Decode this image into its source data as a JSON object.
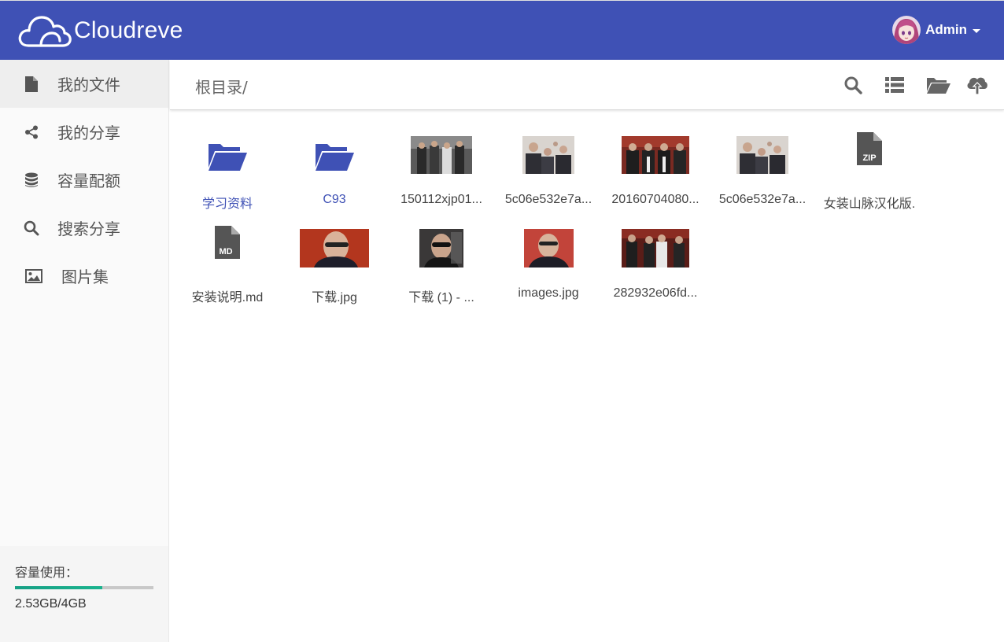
{
  "app": {
    "title": "Cloudreve",
    "brand_color": "#3f51b5"
  },
  "user": {
    "name": "Admin"
  },
  "sidebar": {
    "items": [
      {
        "label": "我的文件",
        "icon": "file-icon",
        "active": true
      },
      {
        "label": "我的分享",
        "icon": "share-icon",
        "active": false
      },
      {
        "label": "容量配额",
        "icon": "database-icon",
        "active": false
      },
      {
        "label": "搜索分享",
        "icon": "search-icon",
        "active": false
      },
      {
        "label": "图片集",
        "icon": "image-icon",
        "active": false
      }
    ],
    "storage": {
      "label": "容量使用：",
      "text": "2.53GB/4GB",
      "used_fraction": 0.63
    }
  },
  "toolbar": {
    "breadcrumb": "根目录/",
    "tools": [
      "search-icon",
      "list-view-icon",
      "folder-open-icon",
      "upload-cloud-icon"
    ]
  },
  "files": [
    {
      "name": "学习资料",
      "type": "folder"
    },
    {
      "name": "C93",
      "type": "folder"
    },
    {
      "name": "150112xjp01...",
      "type": "image"
    },
    {
      "name": "5c06e532e7a...",
      "type": "image"
    },
    {
      "name": "20160704080...",
      "type": "image"
    },
    {
      "name": "5c06e532e7a...",
      "type": "image"
    },
    {
      "name": "女装山脉汉化版.",
      "type": "zip",
      "badge": "ZIP"
    },
    {
      "name": "安装说明.md",
      "type": "md",
      "badge": "MD"
    },
    {
      "name": "下载.jpg",
      "type": "image"
    },
    {
      "name": "下载 (1) - ...",
      "type": "image"
    },
    {
      "name": "images.jpg",
      "type": "image"
    },
    {
      "name": "282932e06fd...",
      "type": "image"
    }
  ]
}
